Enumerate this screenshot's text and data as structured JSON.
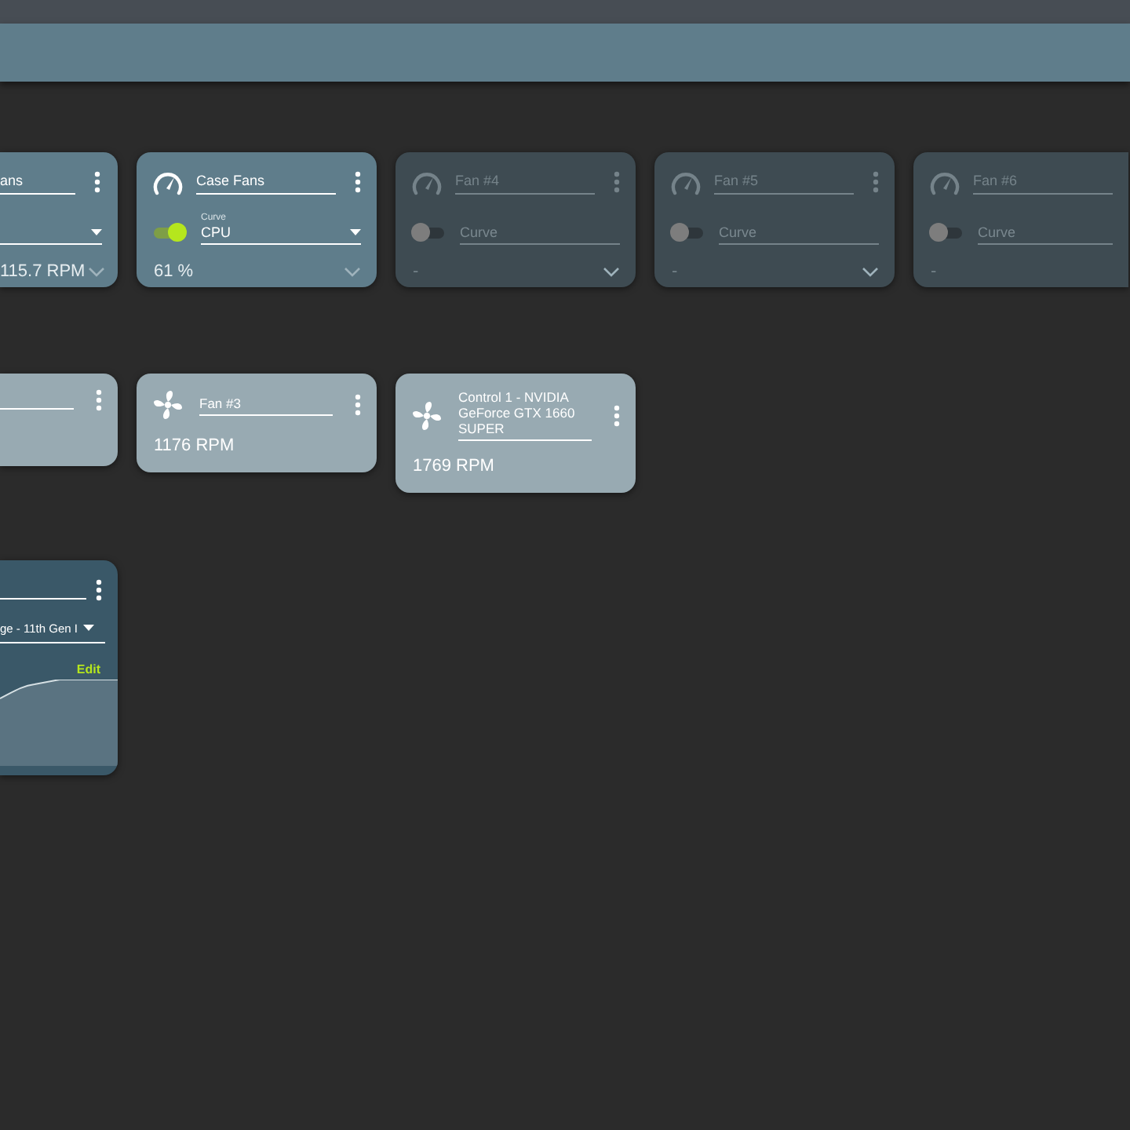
{
  "controls": [
    {
      "kind": "left",
      "name": "ans",
      "value": "115.7 RPM",
      "enabled": true
    },
    {
      "kind": "full",
      "name": "Case Fans",
      "curve_label": "Curve",
      "curve": "CPU",
      "value": "61 %",
      "enabled": true,
      "toggle_on": true
    },
    {
      "kind": "full",
      "name": "Fan #4",
      "curve_placeholder": "Curve",
      "value": "-",
      "enabled": false,
      "toggle_on": false
    },
    {
      "kind": "full",
      "name": "Fan #5",
      "curve_placeholder": "Curve",
      "value": "-",
      "enabled": false,
      "toggle_on": false
    },
    {
      "kind": "right",
      "name": "Fan #6",
      "curve_placeholder": "Curve",
      "value": "-",
      "enabled": false,
      "toggle_on": false
    }
  ],
  "speeds": [
    {
      "kind": "left"
    },
    {
      "kind": "full",
      "name": "Fan #3",
      "value": "1176 RPM"
    },
    {
      "kind": "full",
      "name": "Control 1 - NVIDIA GeForce GTX 1660 SUPER",
      "value": "1769 RPM"
    }
  ],
  "curves": [
    {
      "kind": "left",
      "sensor": "ge - 11th Gen I",
      "action": "Edit"
    }
  ]
}
